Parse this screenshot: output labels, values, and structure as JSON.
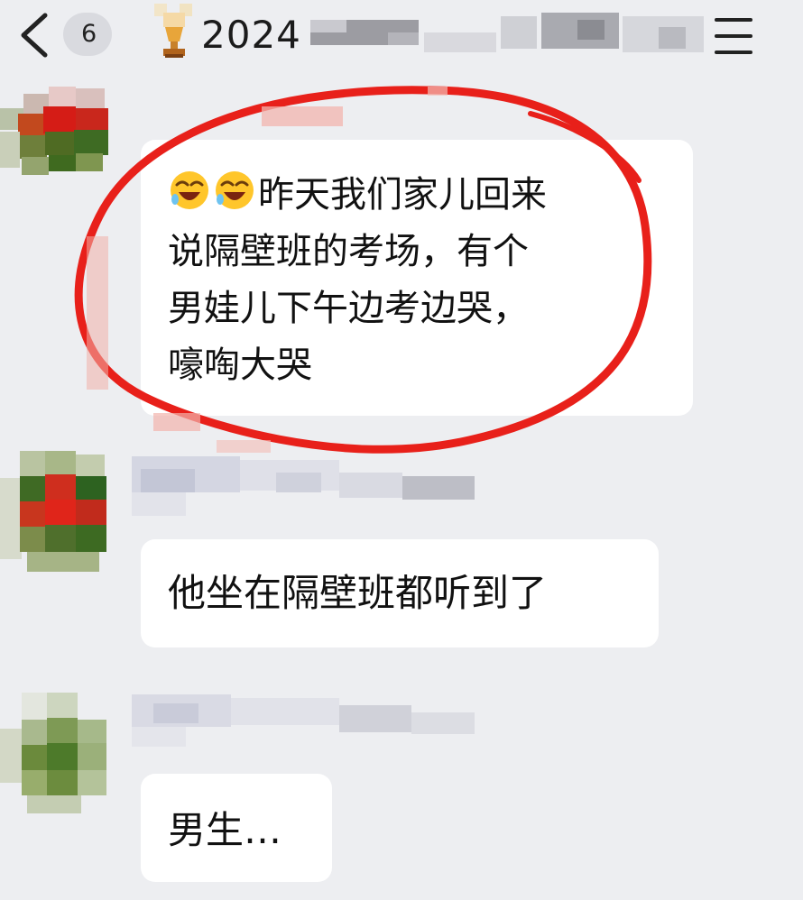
{
  "header": {
    "back_icon": "chevron-left-icon",
    "unread_count": "6",
    "group_icon": "trophy-emoji-icon",
    "title": "2024",
    "menu_icon": "menu-icon"
  },
  "messages": [
    {
      "lines": [
        "昨天我们家儿回来",
        "说隔壁班的考场，有个",
        "男娃儿下午边考边哭，",
        "嚎啕大哭"
      ],
      "emoji": [
        "laughing-crying-face-icon",
        "laughing-crying-face-icon"
      ],
      "highlighted": true
    },
    {
      "text": "他坐在隔壁班都听到了"
    },
    {
      "text": "男生…"
    }
  ],
  "colors": {
    "background": "#edeef1",
    "bubble": "#ffffff",
    "annotation": "#e8201a",
    "text": "#111111"
  }
}
